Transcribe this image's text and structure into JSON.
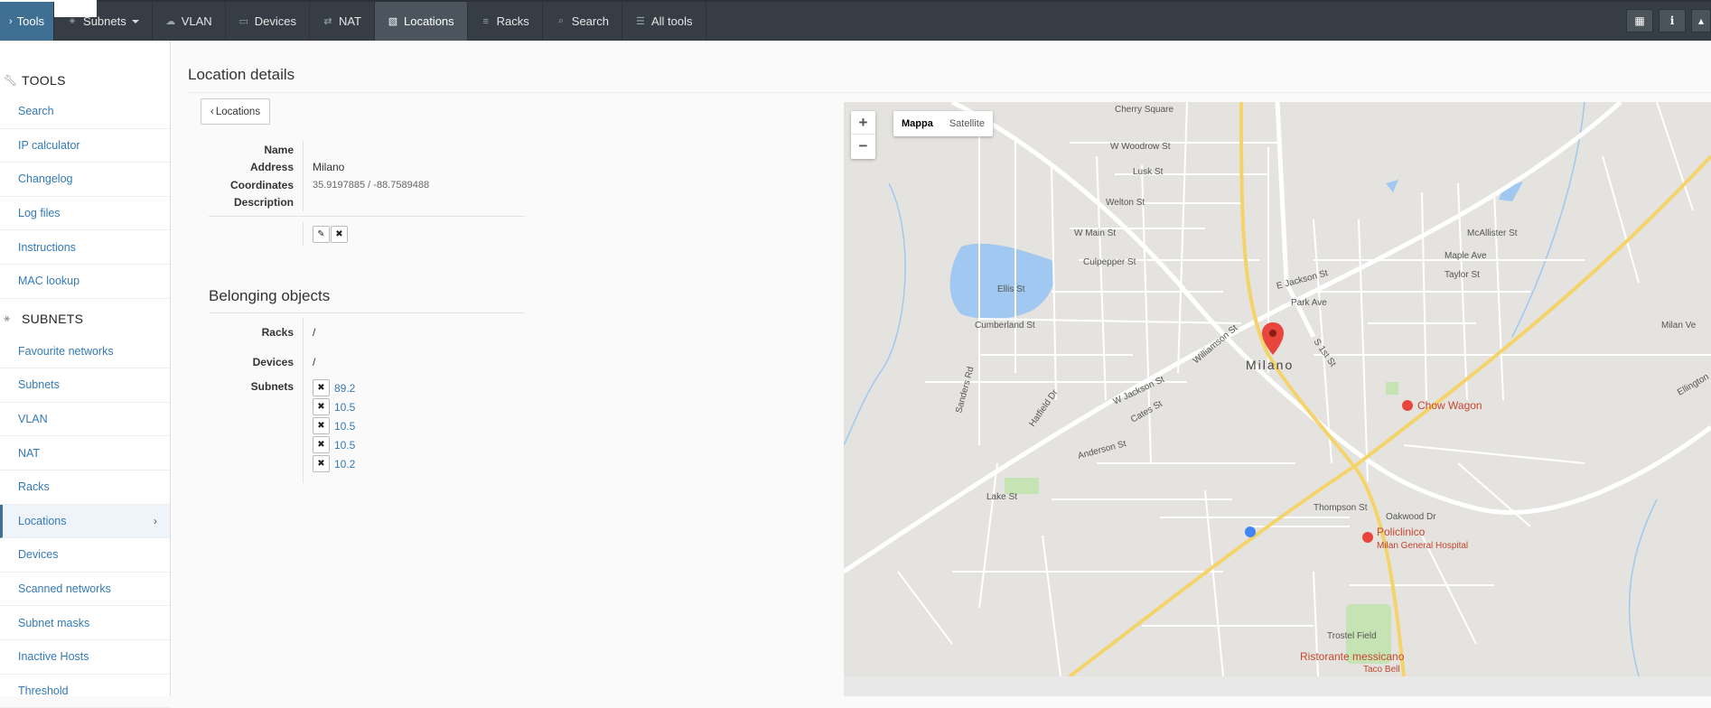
{
  "topbar": {
    "tools_label": "Tools",
    "items": [
      {
        "label": "Subnets",
        "icon": "sitemap-icon",
        "glyph": "⚹",
        "dropdown": true
      },
      {
        "label": "VLAN",
        "icon": "cloud-icon",
        "glyph": "☁"
      },
      {
        "label": "Devices",
        "icon": "desktop-icon",
        "glyph": "▭"
      },
      {
        "label": "NAT",
        "icon": "exchange-icon",
        "glyph": "⇄"
      },
      {
        "label": "Locations",
        "icon": "map-icon",
        "glyph": "▧",
        "active": true
      },
      {
        "label": "Racks",
        "icon": "bars-icon",
        "glyph": "≡"
      },
      {
        "label": "Search",
        "icon": "search-icon",
        "glyph": "⌕"
      },
      {
        "label": "All tools",
        "icon": "list-icon",
        "glyph": "☰"
      }
    ]
  },
  "sidebar": {
    "tools_heading": "TOOLS",
    "tools_items": [
      "Search",
      "IP calculator",
      "Changelog",
      "Log files",
      "Instructions",
      "MAC lookup"
    ],
    "subnets_heading": "SUBNETS",
    "subnets_items": [
      "Favourite networks",
      "Subnets",
      "VLAN",
      "NAT",
      "Racks",
      "Locations",
      "Devices",
      "Scanned networks",
      "Subnet masks",
      "Inactive Hosts",
      "Threshold"
    ],
    "active_item": "Locations"
  },
  "main": {
    "title": "Location details",
    "back_label": "Locations",
    "details": {
      "name_label": "Name",
      "name_value": "",
      "address_label": "Address",
      "address_value": "Milano",
      "coordinates_label": "Coordinates",
      "coordinates_value": "35.9197885 / -88.7589488",
      "description_label": "Description",
      "description_value": ""
    },
    "belonging_title": "Belonging objects",
    "racks_label": "Racks",
    "racks_value": "/",
    "devices_label": "Devices",
    "devices_value": "/",
    "subnets_label": "Subnets",
    "subnets": [
      "89.2",
      "10.5",
      "10.5",
      "10.5",
      "10.2"
    ]
  },
  "map": {
    "map_label": "Mappa",
    "satellite_label": "Satellite",
    "zoom_in": "+",
    "zoom_out": "−",
    "city_label": "Milano",
    "labels": [
      {
        "text": "Cherry Square"
      },
      {
        "text": "W Woodrow St"
      },
      {
        "text": "Lusk St"
      },
      {
        "text": "Welton St"
      },
      {
        "text": "W Main St"
      },
      {
        "text": "Culpepper St"
      },
      {
        "text": "Ellis St"
      },
      {
        "text": "Cumberland St"
      },
      {
        "text": "Park Ave"
      },
      {
        "text": "E Jackson St"
      },
      {
        "text": "Maple Ave"
      },
      {
        "text": "Taylor St"
      },
      {
        "text": "McAllister St"
      },
      {
        "text": "S 1st St"
      },
      {
        "text": "Williamson St"
      },
      {
        "text": "W Jackson St"
      },
      {
        "text": "Cates St"
      },
      {
        "text": "Anderson St"
      },
      {
        "text": "Thompson St"
      },
      {
        "text": "Oakwood Dr"
      },
      {
        "text": "Lake St"
      },
      {
        "text": "Trostel Field"
      },
      {
        "text": "Hatfield Dr"
      },
      {
        "text": "Sanders Rd"
      },
      {
        "text": "Milan Ve"
      },
      {
        "text": "Ellington"
      }
    ],
    "poi_chow_wagon": "Chow Wagon",
    "poi_policlinico": "Policlinico",
    "poi_hospital": "Milan General Hospital",
    "poi_ristorante": "Ristorante messicano",
    "poi_taco_bell": "Taco Bell",
    "colors": {
      "land": "#e5e3df",
      "road": "#ffffff",
      "highway": "#f5d36b",
      "water": "#a0c8f0",
      "park": "#c6e3b4",
      "marker": "#e8453c"
    }
  }
}
